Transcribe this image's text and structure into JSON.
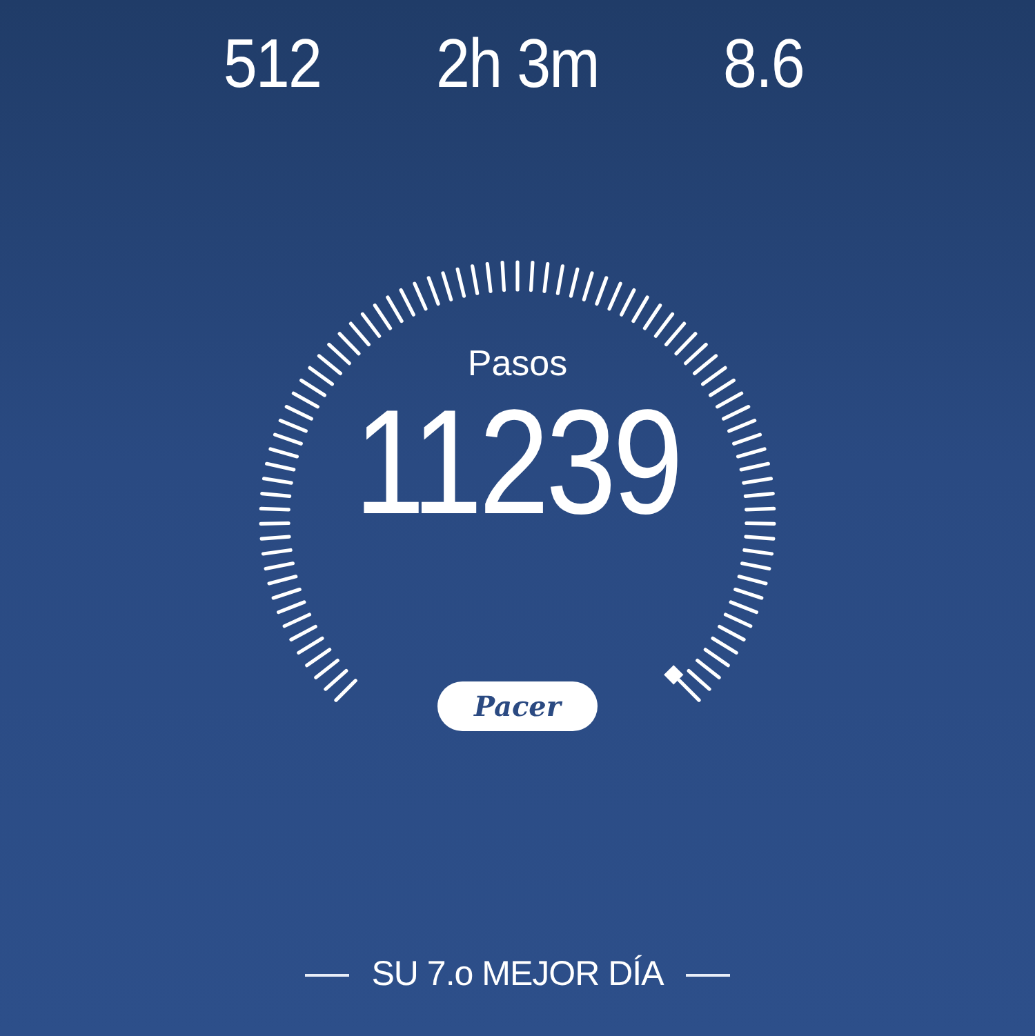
{
  "stats": [
    {
      "value": "512"
    },
    {
      "value": "2h 3m"
    },
    {
      "value": "8.6"
    }
  ],
  "gauge": {
    "label": "Pasos",
    "value": "11239"
  },
  "logo": {
    "text": "Pacer"
  },
  "rank": {
    "text": "SU 7.o MEJOR DÍA"
  }
}
